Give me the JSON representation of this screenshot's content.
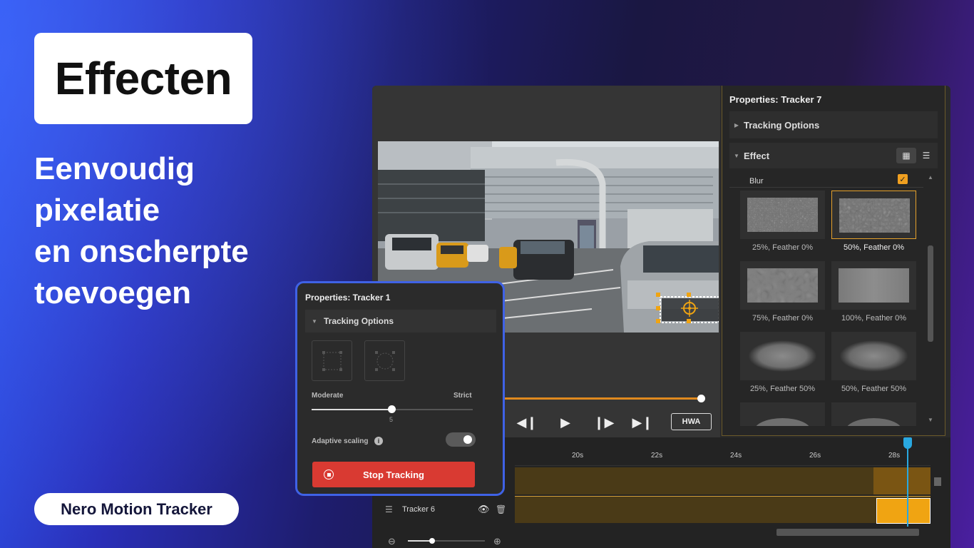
{
  "hero": {
    "title": "Effecten",
    "subtitle_lines": [
      "Eenvoudig",
      "pixelatie",
      "en onscherpte",
      "toevoegen"
    ],
    "brand": "Nero Motion Tracker"
  },
  "player": {
    "hwa_label": "HWA",
    "scrub_progress": 0.97
  },
  "properties_tracker7": {
    "title": "Properties: Tracker 7",
    "tracking_options": "Tracking Options",
    "effect": "Effect",
    "blur_label": "Blur",
    "blur_enabled": true,
    "presets": [
      {
        "caption": "25%, Feather 0%",
        "selected": false
      },
      {
        "caption": "50%, Feather 0%",
        "selected": true
      },
      {
        "caption": "75%, Feather 0%",
        "selected": false
      },
      {
        "caption": "100%, Feather 0%",
        "selected": false
      },
      {
        "caption": "25%, Feather 50%",
        "selected": false
      },
      {
        "caption": "50%, Feather 50%",
        "selected": false
      }
    ]
  },
  "timeline": {
    "ticks": [
      "20s",
      "22s",
      "24s",
      "26s",
      "28s"
    ],
    "track_label": "Tracker 6"
  },
  "properties_tracker1": {
    "title": "Properties: Tracker 1",
    "tracking_options": "Tracking Options",
    "moderate": "Moderate",
    "strict": "Strict",
    "slider_value": "5",
    "adaptive_scaling": "Adaptive scaling",
    "adaptive_scaling_on": true,
    "stop_button": "Stop Tracking"
  },
  "colors": {
    "accent_orange": "#f0a412",
    "stop_red": "#d93a32",
    "panel_border_blue": "#3f62e6",
    "playhead_blue": "#29a8e0"
  }
}
